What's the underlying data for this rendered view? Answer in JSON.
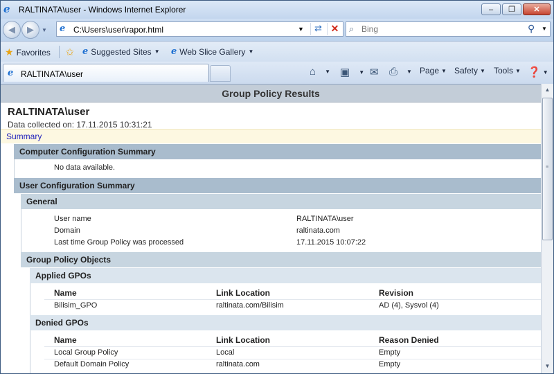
{
  "window": {
    "title": "RALTINATA\\user - Windows Internet Explorer",
    "buttons": {
      "minimize": "–",
      "restore": "❐",
      "close": "✕"
    }
  },
  "addressbar": {
    "url": "C:\\Users\\user\\rapor.html",
    "search_placeholder": "Bing"
  },
  "favorites_bar": {
    "favorites_label": "Favorites",
    "items": [
      "Suggested Sites",
      "Web Slice Gallery"
    ]
  },
  "tabs": [
    {
      "label": "RALTINATA\\user"
    }
  ],
  "command_bar": {
    "page": "Page",
    "safety": "Safety",
    "tools": "Tools"
  },
  "report": {
    "header": "Group Policy Results",
    "heading": "RALTINATA\\user",
    "collected": "Data collected on: 17.11.2015 10:31:21",
    "summary_link": "Summary",
    "computer_config": {
      "title": "Computer Configuration Summary",
      "message": "No data available."
    },
    "user_config": {
      "title": "User Configuration Summary",
      "general": {
        "title": "General",
        "rows": [
          {
            "label": "User name",
            "value": "RALTINATA\\user"
          },
          {
            "label": "Domain",
            "value": "raltinata.com"
          },
          {
            "label": "Last time Group Policy was processed",
            "value": "17.11.2015 10:07:22"
          }
        ]
      },
      "gpo": {
        "title": "Group Policy Objects",
        "applied": {
          "title": "Applied GPOs",
          "columns": [
            "Name",
            "Link Location",
            "Revision"
          ],
          "rows": [
            [
              "Bilisim_GPO",
              "raltinata.com/Bilisim",
              "AD (4), Sysvol (4)"
            ]
          ]
        },
        "denied": {
          "title": "Denied GPOs",
          "columns": [
            "Name",
            "Link Location",
            "Reason Denied"
          ],
          "rows": [
            [
              "Local Group Policy",
              "Local",
              "Empty"
            ],
            [
              "Default Domain Policy",
              "raltinata.com",
              "Empty"
            ]
          ]
        }
      }
    }
  },
  "colors": {
    "header_band": "#c3cdd8",
    "section_l1": "#a9bccd",
    "section_l2": "#c7d5e0",
    "section_l3": "#dbe5ee",
    "summary_bar": "#fdf8e1",
    "link": "#2222bb"
  }
}
